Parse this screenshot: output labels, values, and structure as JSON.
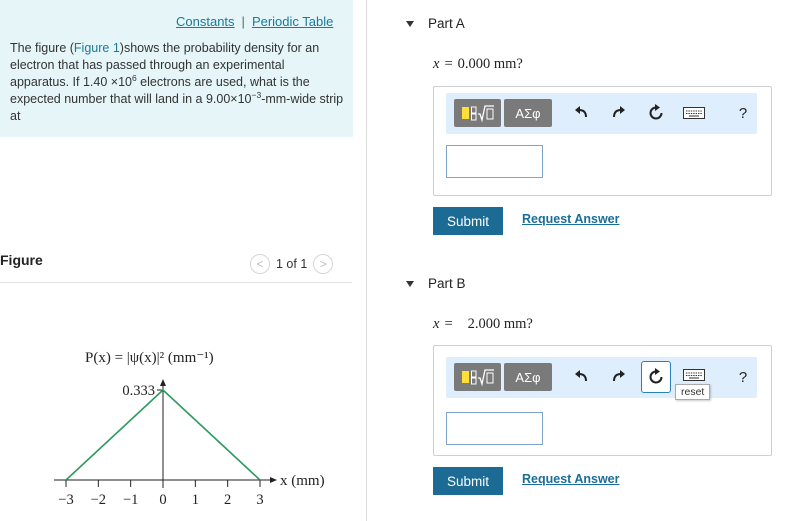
{
  "header_links": {
    "constants": "Constants",
    "separator": "|",
    "periodic_table": "Periodic Table"
  },
  "problem": {
    "text_1": "The figure (",
    "figure_link": "Figure 1",
    "text_2": ")shows the probability density for an electron that has passed through an experimental apparatus. If 1.40 ×10",
    "exp_1": "6",
    "text_3": " electrons are used, what is the expected number that will land in a 9.00×10",
    "exp_2": "−3",
    "text_4": "-mm-wide strip at"
  },
  "figure_panel": {
    "label": "Figure",
    "pager_text": "1 of 1",
    "prev_glyph": "<",
    "next_glyph": ">"
  },
  "chart_data": {
    "type": "line",
    "title": "P(x) = |ψ(x)|² (mm⁻¹)",
    "xlabel": "x (mm)",
    "x": [
      -3,
      0,
      3
    ],
    "y": [
      0,
      0.333,
      0
    ],
    "xlim": [
      -3,
      3
    ],
    "ylim": [
      0,
      0.333
    ],
    "x_ticks": [
      "−3",
      "−2",
      "−1",
      "0",
      "1",
      "2",
      "3"
    ],
    "y_tick_label": "0.333",
    "line_color": "#2e9a5e"
  },
  "parts": [
    {
      "label": "Part A",
      "var": "x",
      "eq": "=",
      "value": "0.000 mm?",
      "toolbar": {
        "greek": "ΑΣφ",
        "help": "?"
      },
      "submit": "Submit",
      "request": "Request Answer",
      "input_value": ""
    },
    {
      "label": "Part B",
      "var": "x",
      "eq": "=",
      "value": "2.000 mm?",
      "toolbar": {
        "greek": "ΑΣφ",
        "help": "?"
      },
      "submit": "Submit",
      "request": "Request Answer",
      "input_value": "",
      "tooltip": "reset"
    }
  ],
  "colors": {
    "accent": "#1b6b94",
    "panel_bg": "#e5f5f8",
    "toolbar_bg": "#dfeefc"
  }
}
